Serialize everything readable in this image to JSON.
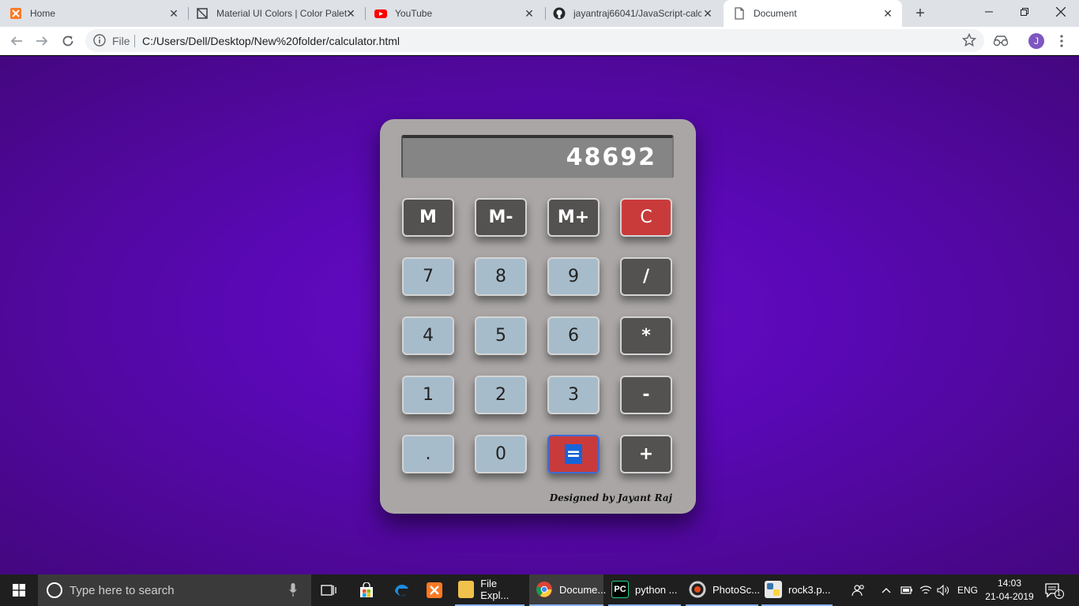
{
  "browser": {
    "tabs": [
      {
        "title": "Home",
        "icon": "xampp-icon"
      },
      {
        "title": "Material UI Colors | Color Palet",
        "icon": "material-icon"
      },
      {
        "title": "YouTube",
        "icon": "youtube-icon"
      },
      {
        "title": "jayantraj66041/JavaScript-calcu",
        "icon": "github-icon"
      },
      {
        "title": "Document",
        "icon": "document-icon"
      }
    ],
    "address": {
      "scheme_label": "File",
      "url": "C:/Users/Dell/Desktop/New%20folder/calculator.html"
    },
    "profile_initial": "J"
  },
  "calculator": {
    "display": "48692",
    "keys": [
      {
        "label": "M",
        "style": "dark"
      },
      {
        "label": "M-",
        "style": "dark"
      },
      {
        "label": "M+",
        "style": "dark"
      },
      {
        "label": "C",
        "style": "red"
      },
      {
        "label": "7",
        "style": "light"
      },
      {
        "label": "8",
        "style": "light"
      },
      {
        "label": "9",
        "style": "light"
      },
      {
        "label": "/",
        "style": "dark"
      },
      {
        "label": "4",
        "style": "light"
      },
      {
        "label": "5",
        "style": "light"
      },
      {
        "label": "6",
        "style": "light"
      },
      {
        "label": "*",
        "style": "dark"
      },
      {
        "label": "1",
        "style": "light"
      },
      {
        "label": "2",
        "style": "light"
      },
      {
        "label": "3",
        "style": "light"
      },
      {
        "label": "-",
        "style": "dark"
      },
      {
        "label": ".",
        "style": "light"
      },
      {
        "label": "0",
        "style": "light"
      },
      {
        "label": "=",
        "style": "red"
      },
      {
        "label": "+",
        "style": "dark"
      }
    ],
    "credit": "Designed by Jayant Raj",
    "colors": {
      "body": "#aaa6a6",
      "dark_key": "#545151",
      "light_key": "#a7bccb",
      "red_key": "#c93b3b",
      "background": "#5b08b8"
    }
  },
  "taskbar": {
    "search_placeholder": "Type here to search",
    "apps": [
      {
        "label": "File Expl...",
        "icon": "file-explorer-icon"
      },
      {
        "label": "Docume...",
        "icon": "chrome-icon"
      },
      {
        "label": "python ...",
        "icon": "pycharm-icon"
      },
      {
        "label": "PhotoSc...",
        "icon": "photoscape-icon"
      },
      {
        "label": "rock3.p...",
        "icon": "python-file-icon"
      }
    ],
    "language": "ENG",
    "time": "14:03",
    "date": "21-04-2019",
    "notification_count": "1"
  }
}
